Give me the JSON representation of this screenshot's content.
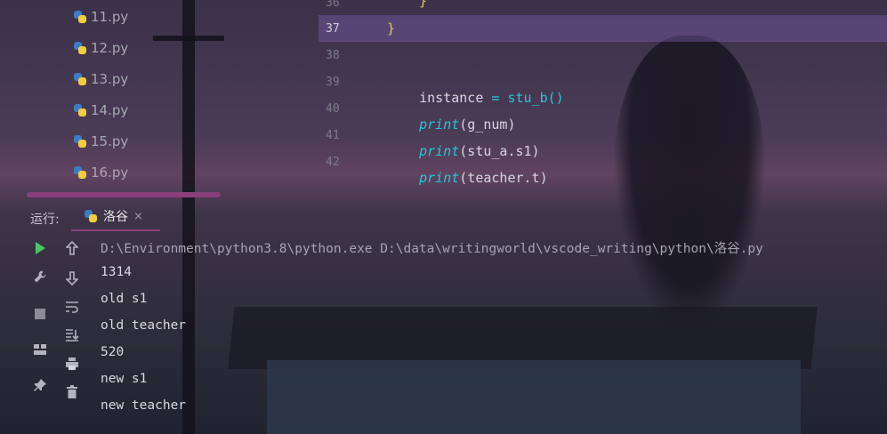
{
  "project_tree": {
    "files": [
      "11.py",
      "12.py",
      "13.py",
      "14.py",
      "15.py",
      "16.py"
    ]
  },
  "editor": {
    "current_line": "37",
    "lines": [
      {
        "num": "36",
        "text": "}"
      },
      {
        "num": "37",
        "text": "}"
      },
      {
        "num": "38",
        "text": ""
      },
      {
        "num": "39",
        "var": "instance",
        "op": " = ",
        "call": "stu_b()"
      },
      {
        "num": "40",
        "fn": "print",
        "arg": "(g_num)"
      },
      {
        "num": "41",
        "fn": "print",
        "arg": "(stu_a.s1)"
      },
      {
        "num": "42",
        "fn": "print",
        "arg": "(teacher.t)"
      }
    ]
  },
  "run": {
    "label": "运行:",
    "tab_name": "洛谷",
    "close": "×",
    "command": "D:\\Environment\\python3.8\\python.exe D:\\data\\writingworld\\vscode_writing\\python\\洛谷.py",
    "output": [
      "1314",
      "old s1",
      "old teacher",
      "520",
      "new s1",
      "new teacher"
    ]
  },
  "icons": {
    "run": "play-icon",
    "settings": "wrench-icon",
    "stop": "stop-icon",
    "layout": "layout-icon",
    "pin": "pin-icon",
    "up": "arrow-up-icon",
    "down": "arrow-down-icon",
    "wrap": "soft-wrap-icon",
    "scroll_end": "scroll-to-end-icon",
    "print": "print-icon",
    "trash": "trash-icon"
  }
}
